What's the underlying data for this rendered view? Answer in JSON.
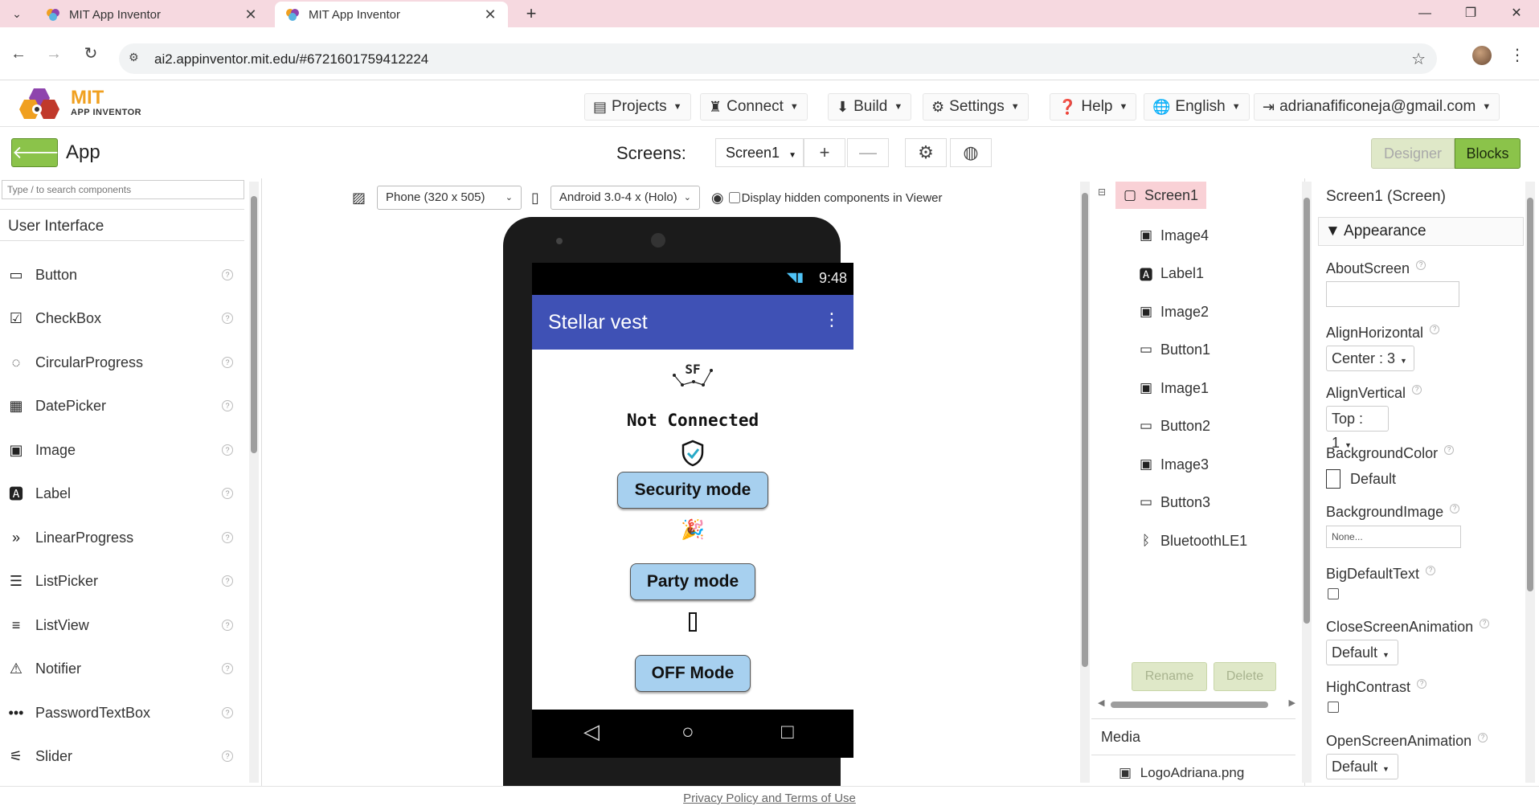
{
  "browser": {
    "tabs": [
      {
        "title": "MIT App Inventor",
        "active": false
      },
      {
        "title": "MIT App Inventor",
        "active": true
      }
    ],
    "url": "ai2.appinventor.mit.edu/#6721601759412224"
  },
  "topbar": {
    "logo_main": "MIT",
    "logo_sub": "APP INVENTOR",
    "menus": {
      "projects": "Projects",
      "connect": "Connect",
      "build": "Build",
      "settings": "Settings",
      "help": "Help",
      "language": "English",
      "account": "adrianafificoneja@gmail.com"
    }
  },
  "toolbar": {
    "app_name": "App",
    "screens_label": "Screens:",
    "current_screen": "Screen1",
    "designer_label": "Designer",
    "blocks_label": "Blocks"
  },
  "palette": {
    "search_placeholder": "Type / to search components",
    "category": "User Interface",
    "items": [
      {
        "label": "Button",
        "icon": "button-icon"
      },
      {
        "label": "CheckBox",
        "icon": "checkbox-icon"
      },
      {
        "label": "CircularProgress",
        "icon": "circular-progress-icon"
      },
      {
        "label": "DatePicker",
        "icon": "calendar-icon"
      },
      {
        "label": "Image",
        "icon": "image-icon"
      },
      {
        "label": "Label",
        "icon": "label-icon"
      },
      {
        "label": "LinearProgress",
        "icon": "linear-progress-icon"
      },
      {
        "label": "ListPicker",
        "icon": "list-picker-icon"
      },
      {
        "label": "ListView",
        "icon": "list-view-icon"
      },
      {
        "label": "Notifier",
        "icon": "warning-icon"
      },
      {
        "label": "PasswordTextBox",
        "icon": "password-icon"
      },
      {
        "label": "Slider",
        "icon": "slider-icon"
      }
    ]
  },
  "viewer": {
    "device_size": "Phone (320 x 505)",
    "theme": "Android 3.0-4 x (Holo)",
    "hidden_label": "Display hidden components in Viewer",
    "status_time": "9:48",
    "app_title": "Stellar vest",
    "logo_text": "SF",
    "status_label": "Not Connected",
    "buttons": {
      "security": "Security mode",
      "party": "Party mode",
      "off": "OFF Mode"
    }
  },
  "components": {
    "root": "Screen1",
    "items": [
      {
        "label": "Image4",
        "icon": "image-icon"
      },
      {
        "label": "Label1",
        "icon": "label-icon"
      },
      {
        "label": "Image2",
        "icon": "image-icon"
      },
      {
        "label": "Button1",
        "icon": "button-icon"
      },
      {
        "label": "Image1",
        "icon": "image-icon"
      },
      {
        "label": "Button2",
        "icon": "button-icon"
      },
      {
        "label": "Image3",
        "icon": "image-icon"
      },
      {
        "label": "Button3",
        "icon": "button-icon"
      },
      {
        "label": "BluetoothLE1",
        "icon": "bluetooth-icon"
      }
    ],
    "rename_label": "Rename",
    "delete_label": "Delete",
    "media_label": "Media",
    "media_item": "LogoAdriana.png"
  },
  "properties": {
    "title": "Screen1 (Screen)",
    "group": "Appearance",
    "about_screen": "AboutScreen",
    "align_horizontal": "AlignHorizontal",
    "align_horizontal_value": "Center : 3",
    "align_vertical": "AlignVertical",
    "align_vertical_value": "Top : 1",
    "background_color": "BackgroundColor",
    "background_color_value": "Default",
    "background_image": "BackgroundImage",
    "background_image_value": "None...",
    "big_default_text": "BigDefaultText",
    "close_screen_animation": "CloseScreenAnimation",
    "close_screen_animation_value": "Default",
    "high_contrast": "HighContrast",
    "open_screen_animation": "OpenScreenAnimation",
    "open_screen_animation_value": "Default"
  },
  "footer": {
    "link": "Privacy Policy and Terms of Use"
  },
  "colors": {
    "accent_green": "#8bc34a",
    "title_bar": "#3f51b5",
    "mode_button": "#a7d0ef",
    "selected_component": "#f9d1d6"
  }
}
